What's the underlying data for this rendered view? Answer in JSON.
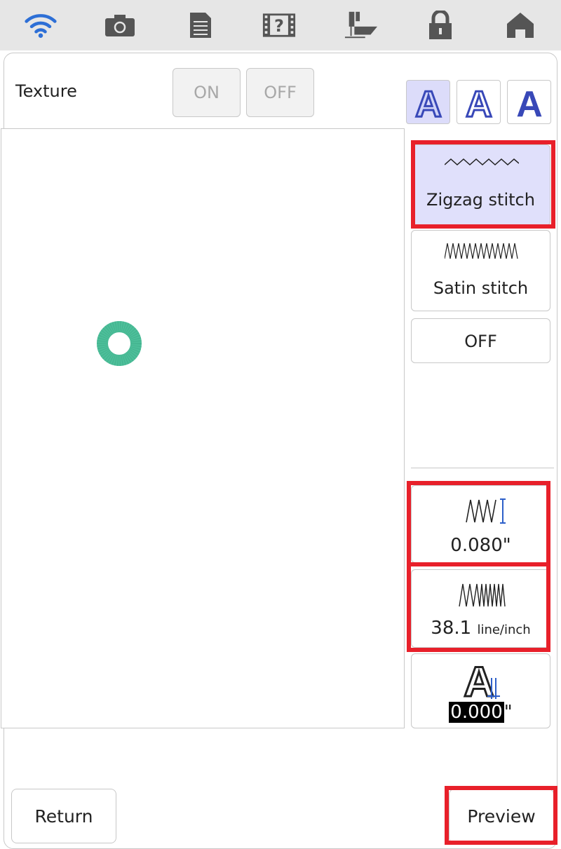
{
  "topbar": {
    "icons": [
      "wifi-icon",
      "camera-icon",
      "document-icon",
      "help-film-icon",
      "sewing-foot-icon",
      "lock-icon",
      "home-icon"
    ]
  },
  "texture": {
    "label": "Texture",
    "on_label": "ON",
    "off_label": "OFF"
  },
  "font_buttons": [
    "A",
    "A",
    "A"
  ],
  "stitch_options": {
    "zigzag_label": "Zigzag stitch",
    "satin_label": "Satin stitch",
    "off_label": "OFF"
  },
  "settings": {
    "width_value": "0.080\"",
    "density_value": "38.1",
    "density_unit": "line/inch",
    "offset_value": "0.000",
    "offset_unit": "\""
  },
  "bottom": {
    "return_label": "Return",
    "preview_label": "Preview"
  },
  "colors": {
    "accent_blue": "#2d6fd6",
    "highlight_red": "#e8202a",
    "stitch_teal": "#4dbf9a",
    "selected_bg": "#e0e0fb"
  }
}
